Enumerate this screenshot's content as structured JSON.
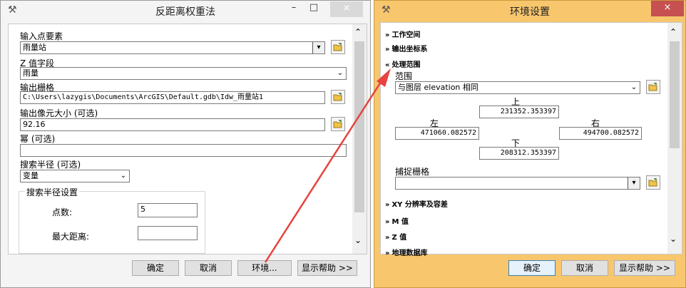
{
  "left_window": {
    "title": "反距离权重法",
    "minimize": "–",
    "maximize": "□",
    "close": "×",
    "tool_icon": "hammer-icon",
    "fields": {
      "input_points_label": "输入点要素",
      "input_points_value": "雨量站",
      "z_field_label": "Z 值字段",
      "z_field_value": "雨量",
      "output_raster_label": "输出栅格",
      "output_raster_value": "C:\\Users\\lazygis\\Documents\\ArcGIS\\Default.gdb\\Idw_雨量站1",
      "cell_size_label": "输出像元大小 (可选)",
      "cell_size_value": "92.16",
      "power_label": "幂 (可选)",
      "power_value": "",
      "search_radius_label": "搜索半径 (可选)",
      "search_radius_value": "变量",
      "search_settings_label": "搜索半径设置",
      "points_label": "点数:",
      "points_value": "5",
      "max_distance_label": "最大距离:",
      "max_distance_value": ""
    },
    "buttons": {
      "ok": "确定",
      "cancel": "取消",
      "environments": "环境...",
      "show_help": "显示帮助 >>"
    }
  },
  "right_window": {
    "title": "环境设置",
    "close": "×",
    "tool_icon": "tools-icon",
    "sections": {
      "workspace": "工作空间",
      "output_coords": "输出坐标系",
      "processing_extent": "处理范围",
      "xy_resolution": "XY 分辨率及容差",
      "m_values": "M 值",
      "z_values": "Z 值",
      "geodatabase": "地理数据库"
    },
    "extent": {
      "label": "范围",
      "value": "与图层 elevation 相同",
      "top_label": "上",
      "top_value": "231352.353397",
      "left_label": "左",
      "left_value": "471060.082572",
      "right_label": "右",
      "right_value": "494700.082572",
      "bottom_label": "下",
      "bottom_value": "208312.353397"
    },
    "snap_raster_label": "捕捉栅格",
    "snap_raster_value": "",
    "buttons": {
      "ok": "确定",
      "cancel": "取消",
      "show_help": "显示帮助 >>"
    }
  },
  "colors": {
    "arrow": "#e8433f",
    "right_frame": "#f7c66d"
  }
}
